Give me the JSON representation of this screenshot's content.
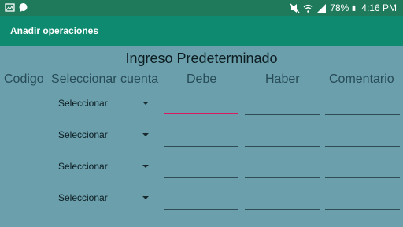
{
  "status_bar": {
    "battery": "78%",
    "time": "4:16 PM"
  },
  "app_bar": {
    "title": "Anadir operaciones"
  },
  "section": {
    "title": "Ingreso Predeterminado"
  },
  "columns": [
    "Codigo",
    "Seleccionar cuenta",
    "Debe",
    "Haber",
    "Comentario"
  ],
  "rows": [
    {
      "account": "Seleccionar",
      "debe": "",
      "haber": "",
      "comentario": ""
    },
    {
      "account": "Seleccionar",
      "debe": "",
      "haber": "",
      "comentario": ""
    },
    {
      "account": "Seleccionar",
      "debe": "",
      "haber": "",
      "comentario": ""
    },
    {
      "account": "Seleccionar",
      "debe": "",
      "haber": "",
      "comentario": ""
    }
  ],
  "colors": {
    "background": "#6a9fab",
    "status_bar": "#1f7a5c",
    "app_bar": "#0e8a70",
    "focus_underline": "#d81b60"
  }
}
